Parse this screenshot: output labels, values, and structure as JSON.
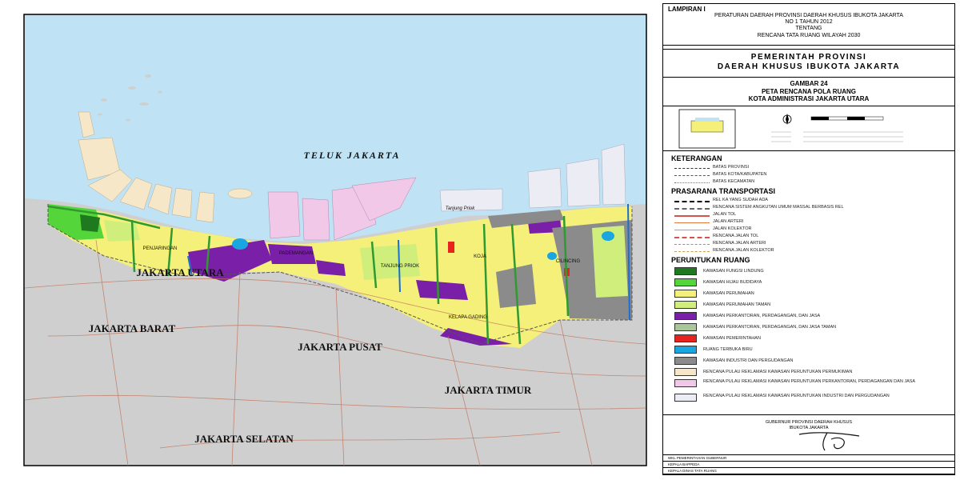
{
  "map": {
    "sea_label": "TELUK JAKARTA",
    "port_label": "Tanjung Priok",
    "region_labels": [
      "JAKARTA UTARA",
      "JAKARTA BARAT",
      "JAKARTA PUSAT",
      "JAKARTA TIMUR",
      "JAKARTA SELATAN"
    ],
    "district_labels": [
      "PENJARINGAN",
      "PADEMANGAN",
      "TANJUNG PRIOK",
      "KOJA",
      "CILINCING",
      "KELAPA GADING"
    ],
    "colors": {
      "sea": "#bfe3f5",
      "land": "#cfcfcf",
      "lindung": "#1f7a1f",
      "hijau": "#54d63a",
      "perumahan": "#f5f07a",
      "taman": "#cfee7c",
      "perkantoran": "#7a1fa8",
      "kantor_taman": "#a9c79a",
      "pemerintahan": "#e8231f",
      "biru": "#1aa6e0",
      "industri": "#8b8b8b",
      "reklamasi_permukiman": "#f6e7c9",
      "reklamasi_perkantoran": "#f2c8e8",
      "reklamasi_industri": "#ececf4"
    }
  },
  "panel": {
    "lampiran": {
      "title": "LAMPIRAN I",
      "lines": [
        "PERATURAN DAERAH PROVINSI DAERAH KHUSUS IBUKOTA JAKARTA",
        "NO 1 TAHUN 2012",
        "TENTANG",
        "RENCANA TATA RUANG WILAYAH 2030"
      ]
    },
    "gov": [
      "PEMERINTAH PROVINSI",
      "DAERAH KHUSUS IBUKOTA JAKARTA"
    ],
    "gambar": [
      "GAMBAR 24",
      "PETA RENCANA POLA RUANG",
      "KOTA ADMINISTRASI JAKARTA UTARA"
    ],
    "legend": {
      "heading": "KETERANGAN",
      "batas": [
        "BATAS PROVINSI",
        "BATAS KOTA/KABUPATEN",
        "BATAS KECAMATAN"
      ],
      "prasarana_heading": "PRASARANA TRANSPORTASI",
      "prasarana": [
        "REL KA YANG SUDAH ADA",
        "RENCANA SISTEM ANGKUTAN UMUM MASSAL BERBASIS REL",
        "JALAN TOL",
        "JALAN ARTERI",
        "JALAN KOLEKTOR",
        "RENCANA JALAN TOL",
        "RENCANA JALAN ARTERI",
        "RENCANA JALAN KOLEKTOR"
      ],
      "peruntukan_heading": "PERUNTUKAN RUANG",
      "peruntukan": [
        "KAWASAN FUNGSI LINDUNG",
        "KAWASAN HIJAU BUDIDAYA",
        "KAWASAN PERUMAHAN",
        "KAWASAN PERUMAHAN TAMAN",
        "KAWASAN PERKANTORAN, PERDAGANGAN, DAN JASA",
        "KAWASAN PERKANTORAN, PERDAGANGAN, DAN JASA TAMAN",
        "KAWASAN PEMERINTAHAN",
        "RUANG TERBUKA BIRU",
        "KAWASAN INDUSTRI DAN PERGUDANGAN",
        "RENCANA PULAU REKLAMASI KAWASAN PERUNTUKAN PERMUKIMAN",
        "RENCANA PULAU REKLAMASI KAWASAN PERUNTUKAN PERKANTORAN, PERDAGANGAN DAN JASA",
        "RENCANA PULAU REKLAMASI KAWASAN PERUNTUKAN INDUSTRI DAN PERGUDANGAN"
      ]
    },
    "signature": [
      "GUBERNUR PROVINSI DAERAH KHUSUS",
      "IBUKOTA JAKARTA"
    ],
    "sign_rows": [
      "WKL PEMERINTAHAN GUBERNUR",
      "KEPALA BAPPEDA",
      "KEPALA DINAS TATA RUANG"
    ]
  }
}
